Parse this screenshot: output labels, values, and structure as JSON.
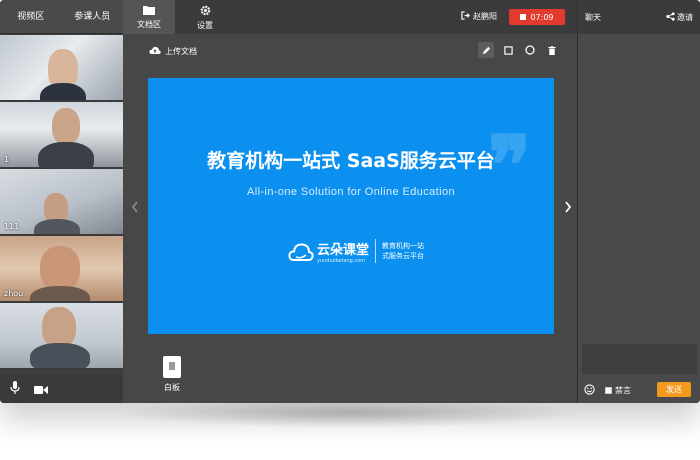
{
  "left_panel": {
    "tabs": [
      {
        "label": "视频区"
      },
      {
        "label": "参课人员"
      }
    ],
    "videos": [
      {
        "name": ""
      },
      {
        "name": "1"
      },
      {
        "name": "111"
      },
      {
        "name": "zhou"
      },
      {
        "name": ""
      }
    ],
    "controls": {
      "mic_icon": "microphone-icon",
      "camera_icon": "camera-icon"
    }
  },
  "top_nav": {
    "items": [
      {
        "label": "文档区",
        "icon": "folder-icon",
        "active": true
      },
      {
        "label": "设置",
        "icon": "gear-icon",
        "active": false
      }
    ],
    "user": {
      "name": "赵鹏阳",
      "icon": "exit-icon"
    },
    "recording": {
      "time": "07:09",
      "color": "#e23a2e"
    }
  },
  "document": {
    "upload_label": "上传文档",
    "tools": [
      {
        "icon": "pencil-icon",
        "active": true
      },
      {
        "icon": "square-icon",
        "active": false
      },
      {
        "icon": "circle-icon",
        "active": false
      },
      {
        "icon": "trash-icon",
        "active": false
      }
    ],
    "slide": {
      "title": "教育机构一站式  SaaS服务云平台",
      "subtitle": "All-in-one Solution for Online Education",
      "logo_name": "云朵课堂",
      "logo_url": "yunduoketang.com",
      "slogan_line1": "教育机构一站",
      "slogan_line2": "式服务云平台",
      "background": "#0b90f0"
    },
    "whiteboard_label": "白板"
  },
  "chat": {
    "title": "聊天",
    "invite_label": "邀请",
    "mute_label": "禁言",
    "send_label": "发送",
    "send_color": "#f39a1e"
  }
}
